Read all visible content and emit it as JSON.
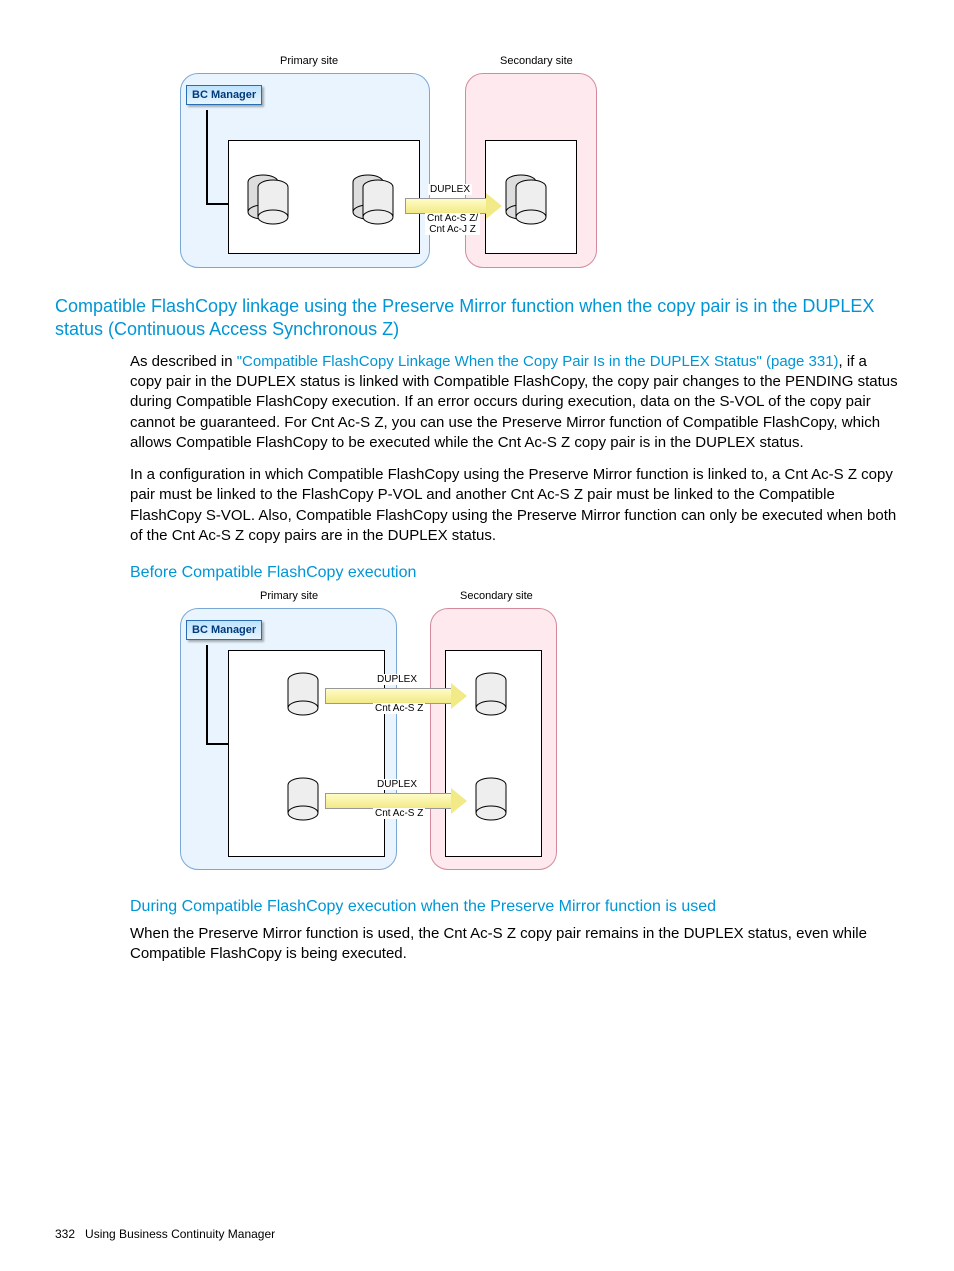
{
  "diagram1": {
    "primary_label": "Primary site",
    "secondary_label": "Secondary site",
    "bc_manager": "BC Manager",
    "arrow_top": "DUPLEX",
    "arrow_bottom": "Cnt Ac-S Z/\nCnt Ac-J Z"
  },
  "section_heading": "Compatible FlashCopy linkage using the Preserve Mirror function when the copy pair is in the DUPLEX status (Continuous Access Synchronous Z)",
  "para1_lead": "As described in ",
  "para1_link": "\"Compatible FlashCopy Linkage When the Copy Pair Is in the DUPLEX Status\" (page 331)",
  "para1_tail": ", if a copy pair in the DUPLEX status is linked with Compatible FlashCopy, the copy pair changes to the PENDING status during Compatible FlashCopy execution. If an error occurs during execution, data on the S-VOL of the copy pair cannot be guaranteed. For Cnt Ac-S Z, you can use the Preserve Mirror function of Compatible FlashCopy, which allows Compatible FlashCopy to be executed while the Cnt Ac-S Z copy pair is in the DUPLEX status.",
  "para2": "In a configuration in which Compatible FlashCopy using the Preserve Mirror function is linked to, a Cnt Ac-S Z copy pair must be linked to the FlashCopy P-VOL and another Cnt Ac-S Z pair must be linked to the Compatible FlashCopy S-VOL. Also, Compatible FlashCopy using the Preserve Mirror function can only be executed when both of the Cnt Ac-S Z copy pairs are in the DUPLEX status.",
  "sub1": "Before Compatible FlashCopy execution",
  "diagram2": {
    "primary_label": "Primary site",
    "secondary_label": "Secondary site",
    "bc_manager": "BC Manager",
    "arrow1_top": "DUPLEX",
    "arrow1_bottom": "Cnt Ac-S Z",
    "arrow2_top": "DUPLEX",
    "arrow2_bottom": "Cnt Ac-S Z"
  },
  "sub2": "During Compatible FlashCopy execution when the Preserve Mirror function is used",
  "para3": "When the Preserve Mirror function is used, the Cnt Ac-S Z copy pair remains in the DUPLEX status, even while Compatible FlashCopy is being executed.",
  "footer_page": "332",
  "footer_text": "Using Business Continuity Manager"
}
